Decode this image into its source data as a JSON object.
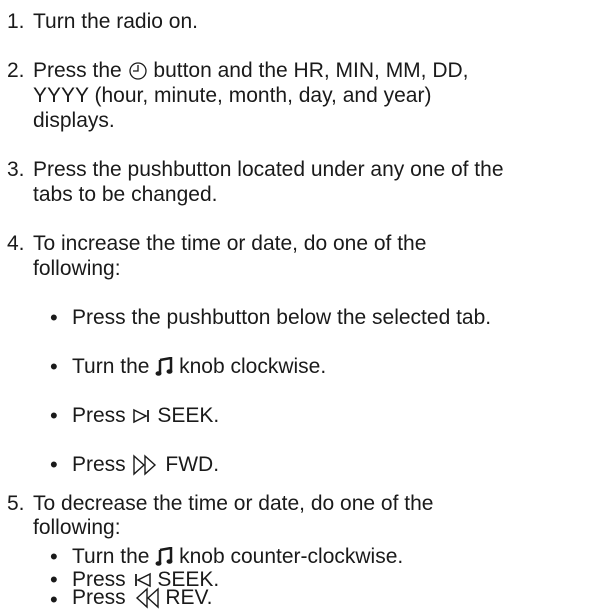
{
  "steps": [
    {
      "number": "1.",
      "lines": [
        "Turn the radio on."
      ]
    },
    {
      "number": "2.",
      "line1_before": "Press the",
      "line1_after": "button and the HR, MIN, MM, DD,",
      "line2": "YYYY (hour, minute, month, day, and year)",
      "line3": "displays."
    },
    {
      "number": "3.",
      "line1": "Press the pushbutton located under any one of the",
      "line2": "tabs to be changed."
    },
    {
      "number": "4.",
      "line1": "To increase the time or date, do one of the",
      "line2": "following:",
      "bullets": [
        {
          "text": "Press the pushbutton below the selected tab."
        },
        {
          "before": "Turn the",
          "after": "knob clockwise.",
          "icon": "music-note-icon"
        },
        {
          "before": "Press",
          "after": "SEEK.",
          "icon": "seek-forward-icon"
        },
        {
          "before": "Press",
          "after": "FWD.",
          "icon": "fast-forward-icon"
        }
      ]
    },
    {
      "number": "5.",
      "line1": "To decrease the time or date, do one of the",
      "line2": "following:",
      "bullets": [
        {
          "before": "Turn the",
          "after": "knob counter-clockwise.",
          "icon": "music-note-icon"
        },
        {
          "before": "Press",
          "after": "SEEK.",
          "icon": "seek-back-icon"
        },
        {
          "before": "Press",
          "after": "REV.",
          "icon": "rewind-icon"
        }
      ]
    }
  ],
  "bullet_glyph": "•"
}
